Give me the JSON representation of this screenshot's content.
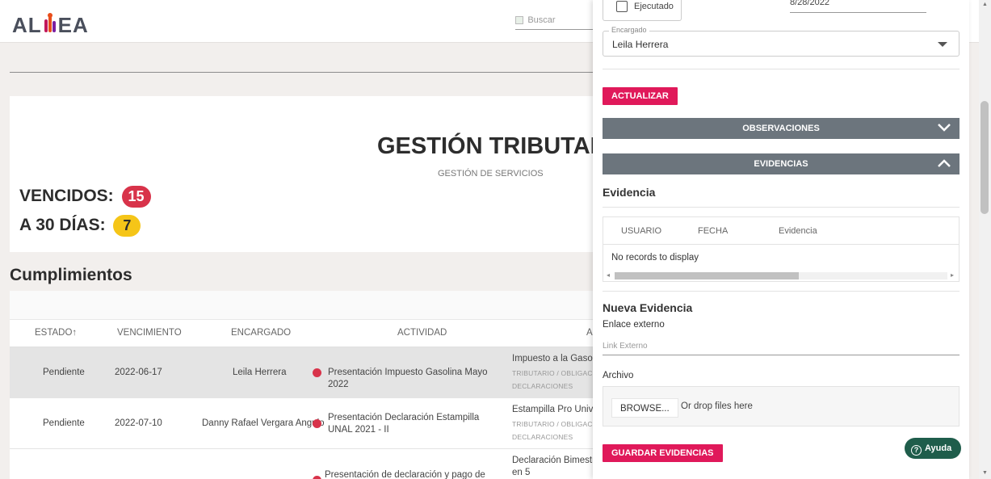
{
  "header": {
    "logo_text": "ALINEA",
    "search_placeholder": "Buscar"
  },
  "summary": {
    "title": "GESTIÓN TRIBUTARIA",
    "subtitle": "GESTIÓN DE SERVICIOS",
    "vencidos_label": "VENCIDOS:",
    "vencidos_count": "15",
    "dias_label": "A 30 DÍAS:",
    "dias_count": "7"
  },
  "cumplimientos": {
    "title": "Cumplimientos",
    "columns": [
      "ESTADO↑",
      "VENCIMIENTO",
      "ENCARGADO",
      "ACTIVIDAD",
      "A"
    ],
    "rows": [
      {
        "estado": "Pendiente",
        "vencimiento": "2022-06-17",
        "encargado": "Leila Herrera",
        "actividad": "Presentación Impuesto Gasolina Mayo 2022",
        "categoria": "Impuesto a la Gasoli",
        "tag1": "TRIBUTARIO / OBLIGACIO",
        "tag2": "DECLARACIONES"
      },
      {
        "estado": "Pendiente",
        "vencimiento": "2022-07-10",
        "encargado": "Danny Rafael Vergara Angulo",
        "actividad": "Presentación Declaración Estampilla UNAL 2021 - II",
        "categoria": "Estampilla Pro Unive",
        "tag1": "TRIBUTARIO / OBLIGACIO",
        "tag2": "DECLARACIONES"
      },
      {
        "estado": "",
        "vencimiento": "",
        "encargado": "",
        "actividad": "Presentación de declaración y pago de IVA",
        "categoria": "Declaración Bimestr",
        "tag1": "en 5",
        "tag2": ""
      }
    ]
  },
  "panel": {
    "ejecutado_label": "Ejecutado",
    "fecha_value": "8/28/2022",
    "encargado_legend": "Encargado",
    "encargado_value": "Leila Herrera",
    "actualizar_label": "ACTUALIZAR",
    "observaciones_label": "OBSERVACIONES",
    "evidencias_label": "EVIDENCIAS",
    "evidencia_title": "Evidencia",
    "evidencia_columns": [
      "USUARIO",
      "FECHA",
      "Evidencia"
    ],
    "no_records": "No records to display",
    "nueva_evidencia_title": "Nueva Evidencia",
    "enlace_label": "Enlace externo",
    "link_placeholder": "Link Externo",
    "archivo_label": "Archivo",
    "browse_label": "BROWSE...",
    "drop_hint": "Or drop files here",
    "guardar_label": "GUARDAR EVIDENCIAS"
  },
  "help": {
    "label": "Ayuda"
  },
  "colors": {
    "accent_pink": "#e0195a",
    "badge_red": "#d8334a",
    "badge_yellow": "#f5c518",
    "accordion_gray": "#6c757d",
    "help_green": "#1f5d4b"
  }
}
